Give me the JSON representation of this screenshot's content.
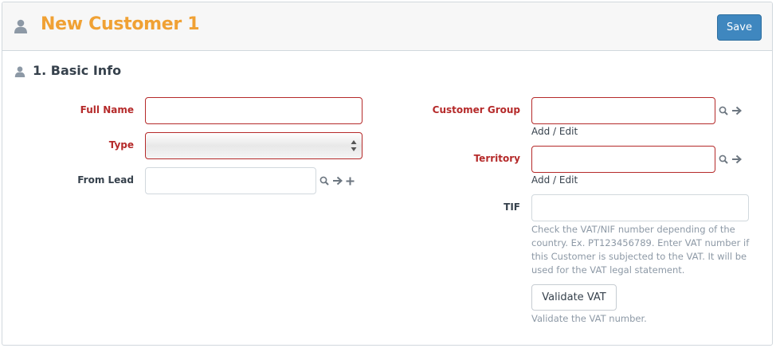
{
  "header": {
    "title": "New Customer 1",
    "icon": "user-icon",
    "save_label": "Save",
    "title_color": "#f0a134",
    "save_color": "#3f87bf"
  },
  "section": {
    "title": "1. Basic Info",
    "icon": "user-icon"
  },
  "left_fields": {
    "full_name": {
      "label": "Full Name",
      "value": "",
      "required": true
    },
    "type": {
      "label": "Type",
      "value": "",
      "required": true
    },
    "from_lead": {
      "label": "From Lead",
      "value": "",
      "required": false
    }
  },
  "right_fields": {
    "customer_group": {
      "label": "Customer Group",
      "value": "",
      "required": true,
      "link": "Add / Edit"
    },
    "territory": {
      "label": "Territory",
      "value": "",
      "required": true,
      "link": "Add / Edit"
    },
    "tif": {
      "label": "TIF",
      "value": "",
      "help": "Check the VAT/NIF number depending of the country. Ex. PT123456789. Enter VAT number if this Customer is subjected to the VAT. It will be used for the VAT legal statement."
    }
  },
  "validate": {
    "label": "Validate VAT",
    "help": "Validate the VAT number."
  },
  "colors": {
    "required_label": "#b52a2a",
    "help_text": "#8d99a6"
  },
  "icons": [
    "search-icon",
    "arrow-right-icon",
    "plus-icon",
    "user-icon",
    "select-arrows-icon"
  ]
}
